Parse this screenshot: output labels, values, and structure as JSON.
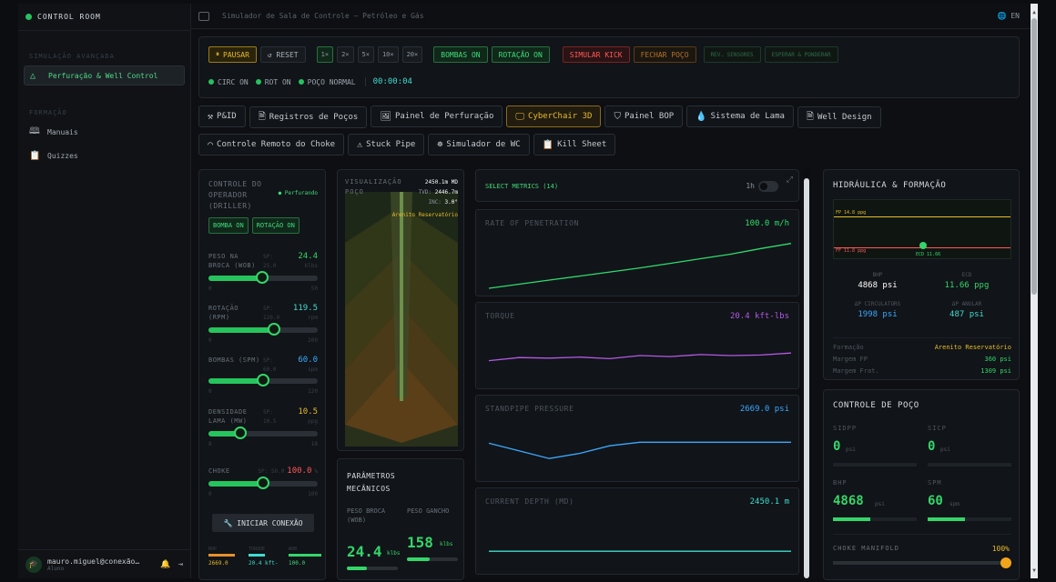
{
  "app": {
    "brand": "CONTROL ROOM",
    "title": "Simulador de Sala de Controle — Petróleo e Gás",
    "lang": "EN"
  },
  "sidebar": {
    "section1": "SIMULAÇÃO AVANÇADA",
    "item_active": "Perfuração & Well Control",
    "section2": "FORMAÇÃO",
    "items": [
      "Manuais",
      "Quizzes"
    ],
    "user_email": "mauro.miguel@conexão…",
    "user_role": "Aluno"
  },
  "controls": {
    "pause": "PAUSAR",
    "reset": "↺ RESET",
    "speeds": [
      "1×",
      "2×",
      "5×",
      "10×",
      "20×"
    ],
    "pumps": "BOMBAS ON",
    "rotation": "ROTAÇÃO ON",
    "kick": "SIMULAR KICK",
    "close_well": "FECHAR POÇO",
    "dim1": "REV. SENSORES",
    "dim2": "ESPERAR & PONDERAR",
    "status": [
      "CIRC ON",
      "ROT ON",
      "POÇO NORMAL"
    ],
    "timer": "00:00:04"
  },
  "tabs": [
    "P&ID",
    "Registros de Poços",
    "Painel de Perfuração",
    "CyberChair 3D",
    "Painel BOP",
    "Sistema de Lama",
    "Well Design",
    "Controle Remoto do Choke",
    "Stuck Pipe",
    "Simulador de WC",
    "Kill Sheet"
  ],
  "operator": {
    "title": "CONTROLE DO OPERADOR (DRILLER)",
    "status": "Perfurando",
    "btn_pump": "BOMBA ON",
    "btn_rot": "ROTAÇÃO ON",
    "sliders": [
      {
        "label": "PESO NA BROCA (WOB)",
        "value": "24.4",
        "sp": "SP:",
        "sp_val": "25.0",
        "unit": "klbs",
        "min": "0",
        "max": "50",
        "pct": 0.49,
        "color": "#34d66a"
      },
      {
        "label": "ROTAÇÃO (RPM)",
        "value": "119.5",
        "sp": "SP:",
        "sp_val": "120.0",
        "unit": "rpm",
        "min": "0",
        "max": "200",
        "pct": 0.6,
        "color": "#3fdcd0"
      },
      {
        "label": "BOMBAS (SPM)",
        "value": "60.0",
        "sp": "SP:",
        "sp_val": "60.0",
        "unit": "spm",
        "min": "0",
        "max": "120",
        "pct": 0.5,
        "color": "#3aa9ff"
      },
      {
        "label": "DENSIDADE LAMA (MW)",
        "value": "10.5",
        "sp": "SP:",
        "sp_val": "10.5",
        "unit": "ppg",
        "min": "8",
        "max": "18",
        "pct": 0.29,
        "color": "#e6bb2b"
      }
    ],
    "choke_label": "CHOKE",
    "choke_sp": "SP: 50.0",
    "choke_value": "100.0",
    "choke_unit": "%",
    "choke_min": "0",
    "choke_max": "100",
    "choke_pct": 0.5,
    "connect": "🔧 INICIAR CONEXÃO",
    "mini": [
      {
        "label": "ROP",
        "value": "2669.0"
      },
      {
        "label": "TORQUE",
        "value": "20.4 kft-"
      },
      {
        "label": "WOB",
        "value": "100.0"
      }
    ]
  },
  "viz": {
    "title": "VISUALIZAÇÃO POÇO",
    "depth_label": "TVD:",
    "depth": "2450.1m MD",
    "tvd": "2446.7m",
    "inc_label": "INC:",
    "inc": "3.0°",
    "formation": "Arenito Reservatório"
  },
  "mech": {
    "title": "PARÂMETROS MECÂNICOS",
    "wob_label": "PESO BROCA (WOB)",
    "wob": "24.4",
    "wob_unit": "klbs",
    "hook_label": "PESO GANCHO",
    "hook": "158",
    "hook_unit": "klbs"
  },
  "metrics": {
    "select": "SELECT METRICS (14)",
    "toggle_label": "1h"
  },
  "chart_data": [
    {
      "type": "line",
      "title": "RATE OF PENETRATION",
      "current": "100.0 m/h",
      "color": "#2fdc6e",
      "x": [
        0,
        1,
        2,
        3,
        4,
        5,
        6,
        7,
        8,
        9,
        10
      ],
      "values": [
        0,
        8,
        16,
        24,
        32,
        40,
        49,
        58,
        67,
        78,
        88
      ],
      "ylim": [
        0,
        100
      ]
    },
    {
      "type": "line",
      "title": "TORQUE",
      "current": "20.4 kft-lbs",
      "color": "#b459e8",
      "x": [
        0,
        1,
        2,
        3,
        4,
        5,
        6,
        7,
        8,
        9,
        10
      ],
      "values": [
        40,
        46,
        45,
        47,
        44,
        50,
        48,
        52,
        50,
        51,
        55
      ],
      "ylim": [
        0,
        100
      ]
    },
    {
      "type": "line",
      "title": "STANDPIPE PRESSURE",
      "current": "2669.0 psi",
      "color": "#3aa9ff",
      "x": [
        0,
        1,
        2,
        3,
        4,
        5,
        6,
        7,
        8,
        9,
        10
      ],
      "values": [
        60,
        45,
        30,
        40,
        55,
        62,
        62,
        62,
        62,
        62,
        62
      ],
      "ylim": [
        0,
        100
      ]
    },
    {
      "type": "line",
      "title": "CURRENT DEPTH (MD)",
      "current": "2450.1 m",
      "color": "#3fdcd0",
      "x": [
        0,
        1,
        2,
        3,
        4,
        5,
        6,
        7,
        8,
        9,
        10
      ],
      "values": [
        30,
        30,
        30,
        30,
        30,
        30,
        30,
        30,
        30,
        30,
        30
      ],
      "ylim": [
        0,
        100
      ]
    }
  ],
  "hydraulics": {
    "title": "HIDRÁULICA & FORMAÇÃO",
    "fp_label": "FP 14.8 ppg",
    "ff_label": "FF 11.8 ppg",
    "ecd_label": "ECD 11.66",
    "bhp_label": "BHP",
    "bhp": "4868 psi",
    "ecd2_label": "ECD",
    "ecd2": "11.66 ppg",
    "dp_label": "ΔP CIRCULATORS",
    "dp": "1998 psi",
    "dp2_label": "ΔP ANULAR",
    "dp2": "487 psi",
    "rows": [
      {
        "k": "Formação",
        "v": "Arenito Reservatório"
      },
      {
        "k": "Margem FP",
        "v": "360 psi"
      },
      {
        "k": "Margem Frat.",
        "v": "1309 psi"
      }
    ]
  },
  "wellcontrol": {
    "title": "CONTROLE DE POÇO",
    "sidpp_label": "SIDPP",
    "sidpp": "0",
    "sicp_label": "SICP",
    "sicp": "0",
    "unit_psi": "psi",
    "bhp_label": "BHP",
    "bhp": "4868",
    "spm_label": "SPM",
    "spm": "60",
    "spm_unit": "spm",
    "choke_label": "CHOKE MANIFOLD",
    "choke_val": "100%",
    "bhp_pct": 0.45,
    "spm_pct": 0.45,
    "choke_pct": 1.0
  }
}
